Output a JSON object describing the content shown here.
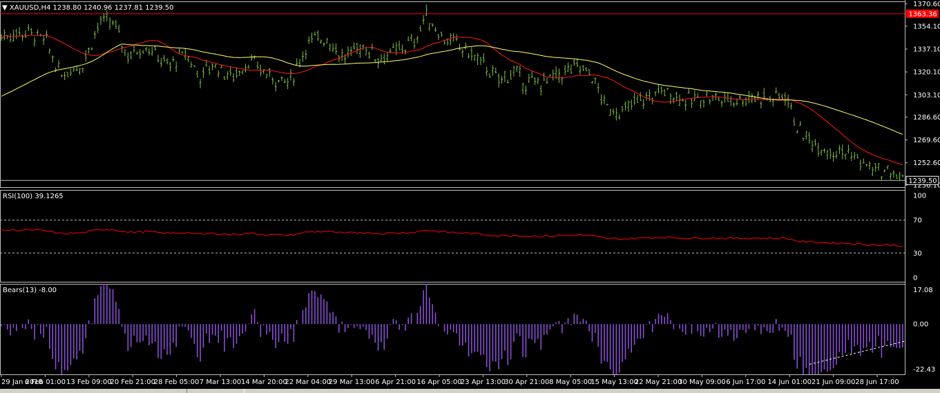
{
  "header": {
    "arrow": "▼",
    "symbol": "XAUUSD,H4",
    "ohlc": "1238.80 1240.96 1237.81 1239.50"
  },
  "price_axis": {
    "ticks": [
      "1370.60",
      "1354.10",
      "1337.10",
      "1320.10",
      "1303.10",
      "1286.60",
      "1269.60",
      "1252.60",
      "1236.10"
    ],
    "tick_values": [
      1370.6,
      1354.1,
      1337.1,
      1320.1,
      1303.1,
      1286.6,
      1269.6,
      1252.6,
      1236.1
    ],
    "red_level_label": "1363.36",
    "current_price_label": "1239.50"
  },
  "rsi": {
    "label": "RSI(100) 39.1265",
    "levels": [
      "100",
      "70",
      "30",
      "0"
    ]
  },
  "bears": {
    "label": "Bears(13) -8.00",
    "levels": [
      "17.08",
      "0.00",
      "-22.43"
    ]
  },
  "time_axis": {
    "labels": [
      "29 Jan 2018",
      "6 Feb 01:00",
      "13 Feb 09:00",
      "20 Feb 21:00",
      "28 Feb 05:00",
      "7 Mar 13:00",
      "14 Mar 20:00",
      "22 Mar 04:00",
      "29 Mar 13:00",
      "6 Apr 21:00",
      "16 Apr 05:00",
      "23 Apr 13:00",
      "30 Apr 21:00",
      "8 May 05:00",
      "15 May 13:00",
      "22 May 21:00",
      "30 May 09:00",
      "6 Jun 17:00",
      "14 Jun 01:00",
      "21 Jun 09:00",
      "28 Jun 17:00"
    ]
  },
  "colors": {
    "background": "#000000",
    "bars": "#7fbf3f",
    "ma_fast": "#ff1a1a",
    "ma_slow": "#ffff66",
    "rsi_line": "#ff0000",
    "bears_hist": "#8a4fd6",
    "red_level": "#ff0000"
  },
  "chart_data": {
    "type": "line",
    "title": "XAUUSD,H4",
    "price_path": [
      [
        0,
        1347
      ],
      [
        0.03,
        1350
      ],
      [
        0.05,
        1342
      ],
      [
        0.065,
        1318
      ],
      [
        0.09,
        1326
      ],
      [
        0.11,
        1358
      ],
      [
        0.125,
        1356
      ],
      [
        0.14,
        1332
      ],
      [
        0.16,
        1340
      ],
      [
        0.185,
        1324
      ],
      [
        0.205,
        1334
      ],
      [
        0.22,
        1316
      ],
      [
        0.235,
        1326
      ],
      [
        0.255,
        1316
      ],
      [
        0.275,
        1328
      ],
      [
        0.3,
        1316
      ],
      [
        0.32,
        1312
      ],
      [
        0.34,
        1342
      ],
      [
        0.36,
        1346
      ],
      [
        0.38,
        1330
      ],
      [
        0.4,
        1340
      ],
      [
        0.42,
        1330
      ],
      [
        0.44,
        1336
      ],
      [
        0.46,
        1344
      ],
      [
        0.47,
        1362
      ],
      [
        0.49,
        1346
      ],
      [
        0.5,
        1342
      ],
      [
        0.515,
        1336
      ],
      [
        0.535,
        1326
      ],
      [
        0.55,
        1314
      ],
      [
        0.57,
        1320
      ],
      [
        0.58,
        1312
      ],
      [
        0.6,
        1312
      ],
      [
        0.62,
        1318
      ],
      [
        0.64,
        1324
      ],
      [
        0.655,
        1318
      ],
      [
        0.67,
        1294
      ],
      [
        0.69,
        1290
      ],
      [
        0.7,
        1296
      ],
      [
        0.72,
        1302
      ],
      [
        0.735,
        1306
      ],
      [
        0.75,
        1302
      ],
      [
        0.765,
        1298
      ],
      [
        0.78,
        1302
      ],
      [
        0.8,
        1300
      ],
      [
        0.82,
        1300
      ],
      [
        0.84,
        1302
      ],
      [
        0.855,
        1300
      ],
      [
        0.87,
        1304
      ],
      [
        0.885,
        1276
      ],
      [
        0.9,
        1268
      ],
      [
        0.92,
        1262
      ],
      [
        0.94,
        1260
      ],
      [
        0.96,
        1250
      ],
      [
        0.975,
        1246
      ],
      [
        0.99,
        1245
      ],
      [
        1,
        1239.5
      ]
    ],
    "rsi_value": 39.1265,
    "bears_value": -8.0
  }
}
